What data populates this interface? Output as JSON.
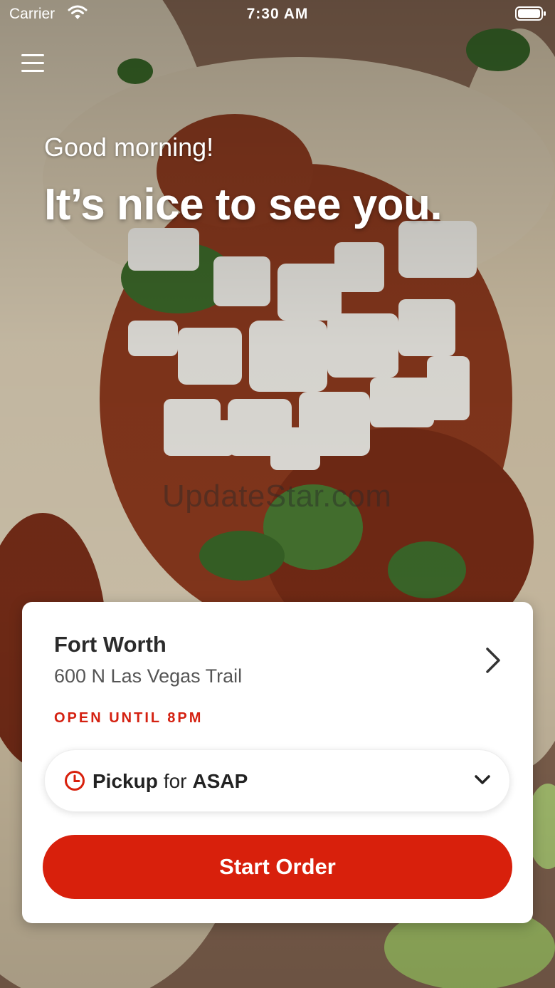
{
  "status_bar": {
    "carrier": "Carrier",
    "time": "7:30 AM"
  },
  "header": {
    "menu_icon": "hamburger-menu-icon",
    "greeting": "Good morning!",
    "headline": "It’s nice to see you."
  },
  "watermark": "UpdateStar.com",
  "location_card": {
    "store_name": "Fort Worth",
    "address": "600 N Las Vegas Trail",
    "open_status": "OPEN UNTIL 8PM",
    "pickup": {
      "mode": "Pickup",
      "connector": "for",
      "time": "ASAP"
    },
    "start_order_label": "Start Order"
  },
  "colors": {
    "accent": "#d8200c",
    "open_status": "#d42010",
    "card_background": "#ffffff"
  },
  "icons": {
    "wifi": "wifi-icon",
    "battery": "battery-icon",
    "clock": "clock-icon",
    "chevron_right": "chevron-right-icon",
    "chevron_down": "chevron-down-icon"
  }
}
